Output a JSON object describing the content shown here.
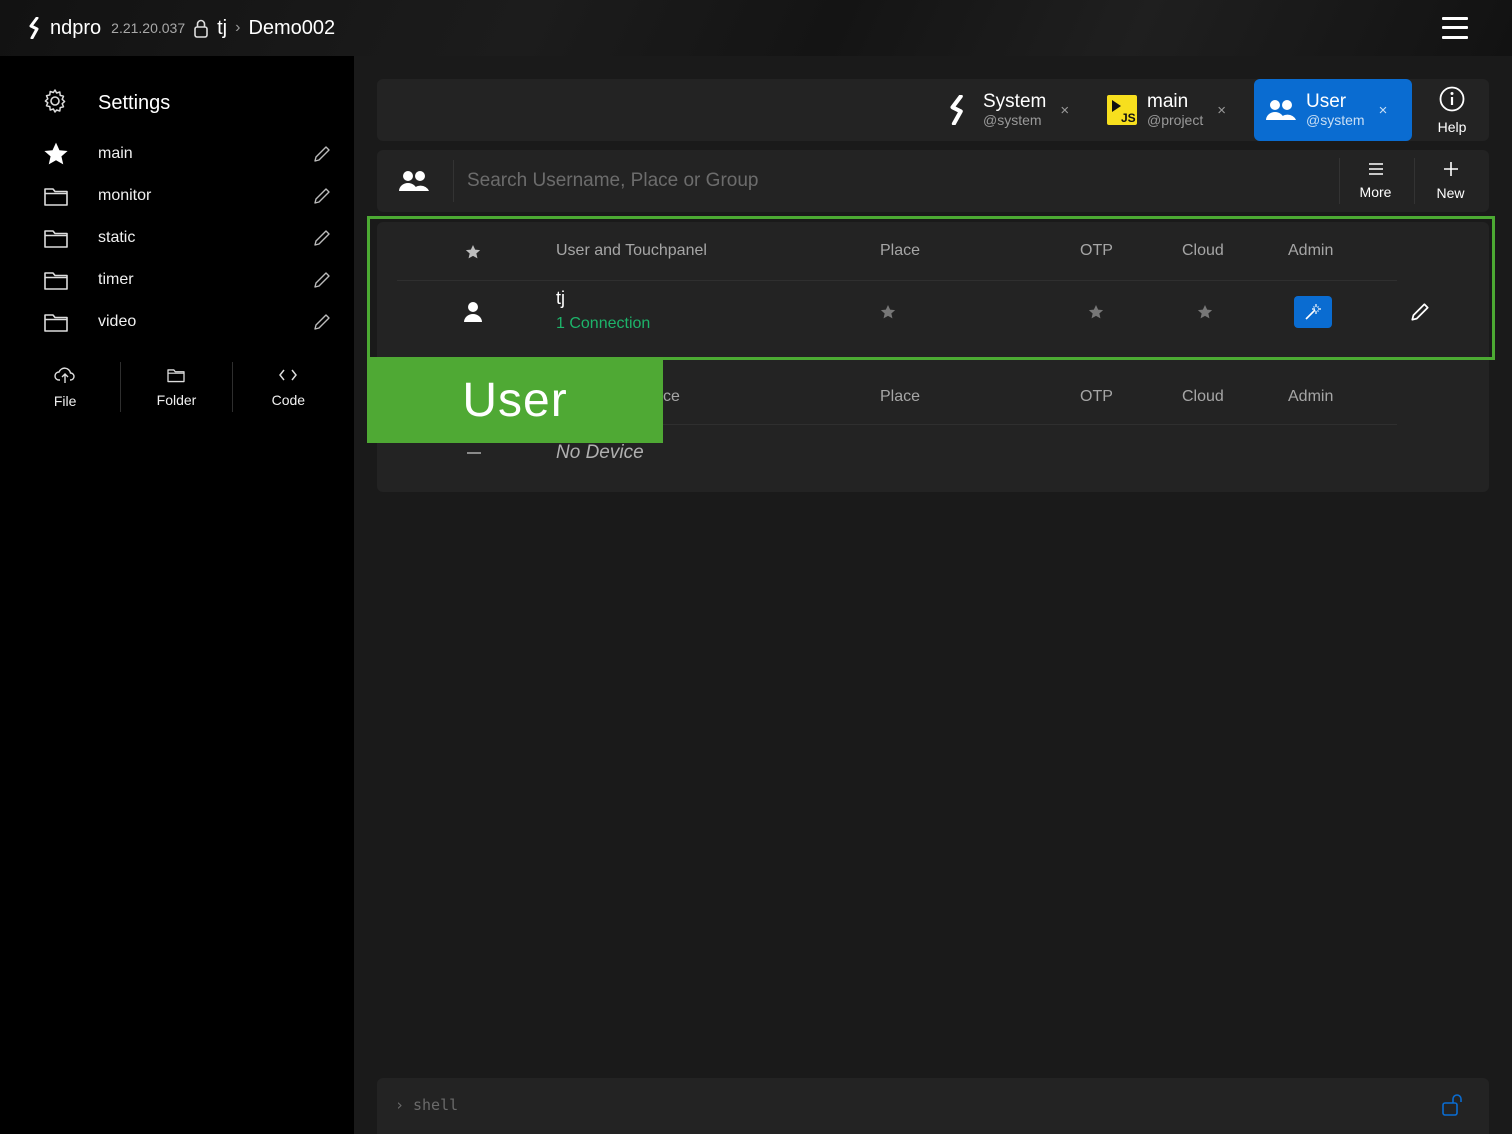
{
  "topbar": {
    "app_name": "ndpro",
    "version": "2.21.20.037",
    "user": "tj",
    "separator": "›",
    "project": "Demo002"
  },
  "sidebar": {
    "header": {
      "label": "Settings",
      "icon": "gear-icon"
    },
    "items": [
      {
        "label": "main",
        "icon": "star-icon"
      },
      {
        "label": "monitor",
        "icon": "folder-icon"
      },
      {
        "label": "static",
        "icon": "folder-icon"
      },
      {
        "label": "timer",
        "icon": "folder-icon"
      },
      {
        "label": "video",
        "icon": "folder-icon"
      }
    ],
    "actions": [
      {
        "label": "File",
        "icon": "cloud-upload-icon"
      },
      {
        "label": "Folder",
        "icon": "folder-icon"
      },
      {
        "label": "Code",
        "icon": "code-icon"
      }
    ]
  },
  "tabs": [
    {
      "name": "System",
      "sub": "@system",
      "icon": "ndpro-logo-icon",
      "close": "×",
      "active": false
    },
    {
      "name": "main",
      "sub": "@project",
      "icon": "javascript-icon",
      "close": "×",
      "active": false
    },
    {
      "name": "User",
      "sub": "@system",
      "icon": "users-icon",
      "close": "×",
      "active": true
    }
  ],
  "help": {
    "label": "Help",
    "icon": "info-icon"
  },
  "search": {
    "placeholder": "Search Username, Place or Group",
    "more_label": "More",
    "new_label": "New"
  },
  "users_table": {
    "headers": [
      "User and Touchpanel",
      "Place",
      "OTP",
      "Cloud",
      "Admin"
    ],
    "rows": [
      {
        "name": "tj",
        "connections": "1 Connection",
        "admin": true
      }
    ]
  },
  "devices_table": {
    "headers": [
      "ce",
      "Place",
      "OTP",
      "Cloud",
      "Admin"
    ],
    "empty_text": "No Device"
  },
  "callout": {
    "label": "User"
  },
  "shell": {
    "prompt": "›",
    "text": "shell"
  },
  "colors": {
    "accent": "#0a6cd1",
    "connection_green": "#1db36a",
    "highlight_green": "#4fa934",
    "js_yellow": "#f7df1e"
  }
}
